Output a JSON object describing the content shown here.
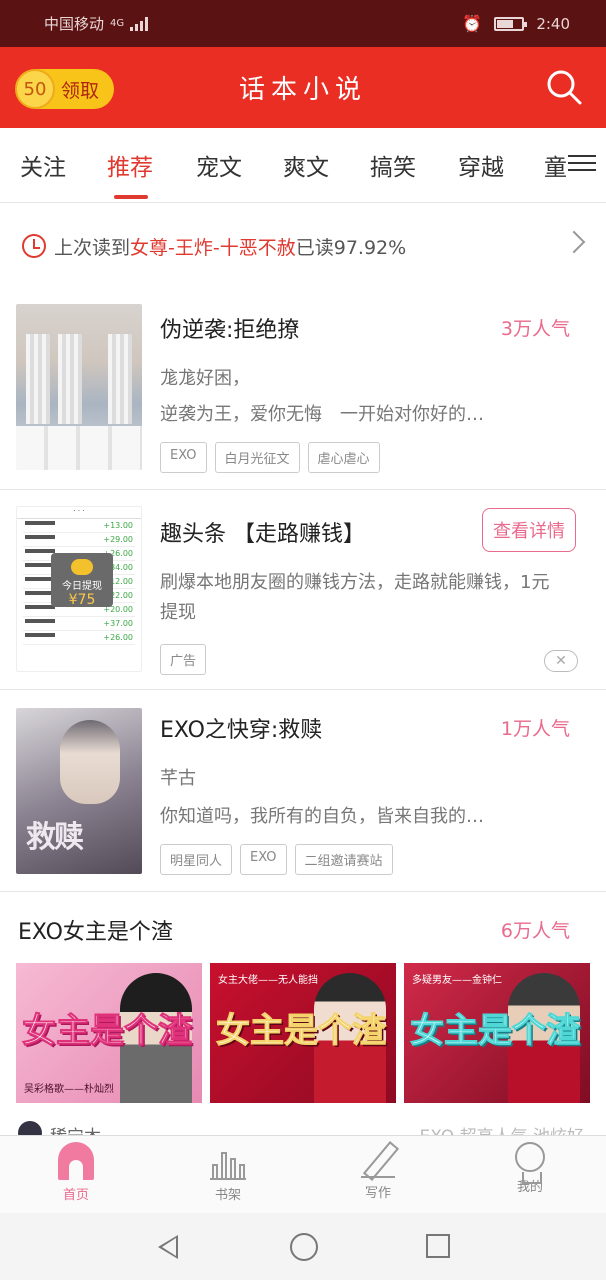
{
  "status_bar": {
    "carrier": "中国移动",
    "network": "4G",
    "time": "2:40"
  },
  "header": {
    "coin_amount": "50",
    "coin_label": "领取",
    "title": "话本小说"
  },
  "tabs": [
    {
      "label": "关注"
    },
    {
      "label": "推荐",
      "active": true
    },
    {
      "label": "宠文"
    },
    {
      "label": "爽文"
    },
    {
      "label": "搞笑"
    },
    {
      "label": "穿越"
    },
    {
      "label": "童"
    }
  ],
  "last_read": {
    "prefix": "上次读到",
    "title": "女尊-王炸-十恶不赦",
    "suffix": "已读97.92%"
  },
  "books": [
    {
      "title": "伪逆袭:拒绝撩",
      "popularity": "3万人气",
      "author": "尨尨好困，",
      "desc": "逆袭为王，爱你无悔　一开始对你好的…",
      "tags": [
        "EXO",
        "白月光征文",
        "虐心虐心"
      ]
    },
    {
      "title": "趣头条 【走路赚钱】",
      "detail_btn": "查看详情",
      "desc": "刷爆本地朋友圈的赚钱方法，走路就能赚钱，1元提现",
      "tags": [
        "广告"
      ],
      "ad_popup_text": "今日提现",
      "ad_popup_amount": "¥75"
    },
    {
      "title": "EXO之快穿:救赎",
      "popularity": "1万人气",
      "author": "芊古",
      "desc": "你知道吗，我所有的自负，皆来自我的…",
      "tags": [
        "明星同人",
        "EXO",
        "二组邀请赛站"
      ],
      "cover_text": "救赎"
    }
  ],
  "featured": {
    "title": "EXO女主是个渣",
    "popularity": "6万人气",
    "banners": [
      {
        "text": "女主是个渣",
        "sub": "",
        "sub2": "吴彩格歌——朴灿烈"
      },
      {
        "text": "女主是个渣",
        "sub": "女主大佬——无人能挡",
        "sub2": ""
      },
      {
        "text": "女主是个渣",
        "sub": "多疑男友——金钟仁",
        "sub2": ""
      }
    ],
    "next_author": "稀宁木",
    "next_title": "EXO 超高人气 池炫好"
  },
  "bottom_nav": [
    {
      "label": "首页",
      "icon": "home-icon",
      "active": true
    },
    {
      "label": "书架",
      "icon": "bookshelf-icon"
    },
    {
      "label": "写作",
      "icon": "pen-icon"
    },
    {
      "label": "我的",
      "icon": "profile-icon"
    }
  ],
  "colors": {
    "brand": "#ea2e23",
    "accent": "#e96a8d",
    "status_bar": "#5a1212"
  }
}
